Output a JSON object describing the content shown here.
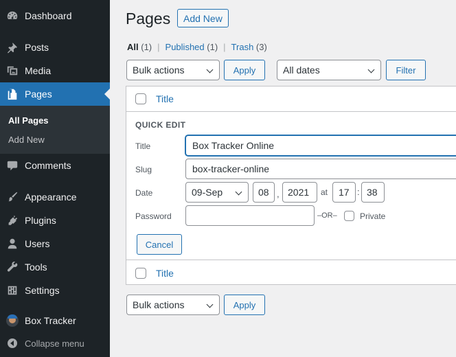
{
  "sidebar": {
    "items": [
      {
        "label": "Dashboard",
        "icon": "dashboard-icon"
      },
      {
        "label": "Posts",
        "icon": "pin-icon"
      },
      {
        "label": "Media",
        "icon": "media-icon"
      },
      {
        "label": "Pages",
        "icon": "pages-icon",
        "active": true
      },
      {
        "label": "Comments",
        "icon": "comment-icon"
      },
      {
        "label": "Appearance",
        "icon": "brush-icon"
      },
      {
        "label": "Plugins",
        "icon": "plug-icon"
      },
      {
        "label": "Users",
        "icon": "user-icon"
      },
      {
        "label": "Tools",
        "icon": "wrench-icon"
      },
      {
        "label": "Settings",
        "icon": "settings-icon"
      },
      {
        "label": "Box Tracker",
        "icon": "avatar"
      }
    ],
    "submenu": [
      {
        "label": "All Pages",
        "current": true
      },
      {
        "label": "Add New"
      }
    ],
    "collapse_label": "Collapse menu"
  },
  "header": {
    "title": "Pages",
    "add_new_label": "Add New"
  },
  "views": {
    "all": {
      "label": "All",
      "count": "(1)"
    },
    "published": {
      "label": "Published",
      "count": "(1)"
    },
    "trash": {
      "label": "Trash",
      "count": "(3)"
    },
    "separator": "|"
  },
  "filters": {
    "bulk_actions": "Bulk actions",
    "apply_label": "Apply",
    "dates": "All dates",
    "filter_label": "Filter"
  },
  "table": {
    "column_title": "Title"
  },
  "quick_edit": {
    "heading": "QUICK EDIT",
    "title_label": "Title",
    "title_value": "Box Tracker Online",
    "slug_label": "Slug",
    "slug_value": "box-tracker-online",
    "date_label": "Date",
    "month": "09-Sep",
    "day": "08",
    "comma": ",",
    "year": "2021",
    "at": "at",
    "hour": "17",
    "colon": ":",
    "minute": "38",
    "password_label": "Password",
    "password_value": "",
    "or_text": "–OR–",
    "private_label": "Private",
    "cancel_label": "Cancel"
  },
  "bottom": {
    "bulk_actions": "Bulk actions",
    "apply_label": "Apply"
  },
  "colors": {
    "sidebar_bg": "#1d2327",
    "accent": "#2271b1",
    "page_bg": "#f0f0f1"
  }
}
